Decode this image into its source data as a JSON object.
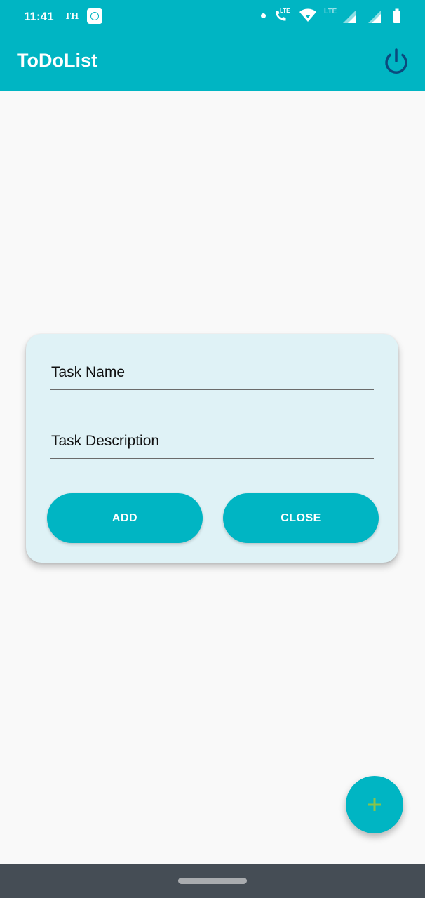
{
  "status_bar": {
    "time": "11:41",
    "carrier_badge": "TH",
    "lte_call_badge": "LTE",
    "lte_badge": "LTE"
  },
  "app_bar": {
    "title": "ToDoList",
    "power_icon": "power-icon"
  },
  "dialog": {
    "task_name_placeholder": "Task Name",
    "task_description_placeholder": "Task Description",
    "add_label": "ADD",
    "close_label": "CLOSE"
  },
  "fab": {
    "icon": "plus-icon"
  },
  "colors": {
    "primary": "#00b5c3",
    "dialog_background": "#dff2f6",
    "fab_plus": "#8bc34a",
    "power_icon": "#0b4a7e",
    "nav_bar": "#454d55"
  }
}
